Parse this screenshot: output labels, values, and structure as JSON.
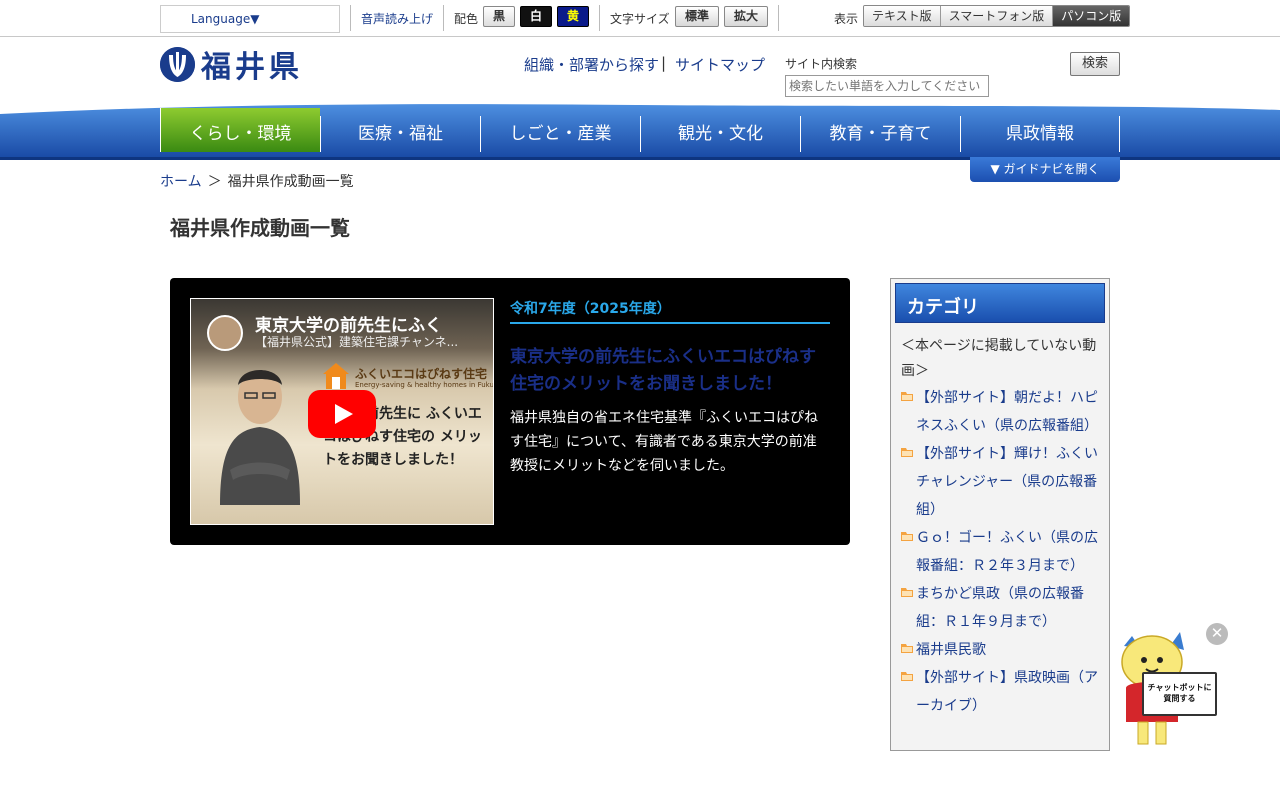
{
  "util": {
    "language": "Language▼",
    "voice": "音声読み上げ",
    "color_label": "配色",
    "color_options": [
      "黒",
      "白",
      "黄"
    ],
    "fontsize_label": "文字サイズ",
    "fontsize_options": [
      "標準",
      "拡大"
    ],
    "display_label": "表示",
    "display_options": [
      "テキスト版",
      "スマートフォン版",
      "パソコン版"
    ],
    "display_active": "パソコン版"
  },
  "header": {
    "logo_text": "福井県",
    "links": [
      "組織・部署から探す",
      "サイトマップ"
    ],
    "search_label": "サイト内検索",
    "search_placeholder": "検索したい単語を入力してください",
    "search_button": "検索"
  },
  "nav": {
    "items": [
      "くらし・環境",
      "医療・福祉",
      "しごと・産業",
      "観光・文化",
      "教育・子育て",
      "県政情報"
    ],
    "active": "くらし・環境"
  },
  "breadcrumb": {
    "home": "ホーム",
    "separator": "＞",
    "current": "福井県作成動画一覧"
  },
  "guide_button": "▼ ガイドナビを開く",
  "page_title": "福井県作成動画一覧",
  "video": {
    "thumb_title": "東京大学の前先生にふく",
    "thumb_channel": "【福井県公式】建築住宅課チャンネ...",
    "eco_brand": "ふくいエコはぴねす住宅",
    "eco_brand_sub": "Energy-saving & healthy homes in Fukui",
    "overlay_text": "大学の前先生に ふくいエコはぴねす住宅の メリットをお聞きしました！",
    "year": "令和7年度（2025年度）",
    "title": "東京大学の前先生にふくいエコはぴねす住宅のメリットをお聞きしました！",
    "description": "福井県独自の省エネ住宅基準『ふくいエコはぴねす住宅』について、有識者である東京大学の前准教授にメリットなどを伺いました。"
  },
  "category": {
    "heading": "カテゴリ",
    "note": "＜本ページに掲載していない動画＞",
    "items": [
      "【外部サイト】朝だよ！ハピネスふくい（県の広報番組）",
      "【外部サイト】輝け！ふくいチャレンジャー（県の広報番組）",
      "Ｇｏ！ゴー！ふくい（県の広報番組：Ｒ２年３月まで）",
      "まちかど県政（県の広報番組：Ｒ１年９月まで）",
      "福井県民歌",
      "【外部サイト】県政映画（アーカイブ）"
    ]
  },
  "chatbot": {
    "sign": "チャットボットに質問する",
    "close": "✕"
  }
}
